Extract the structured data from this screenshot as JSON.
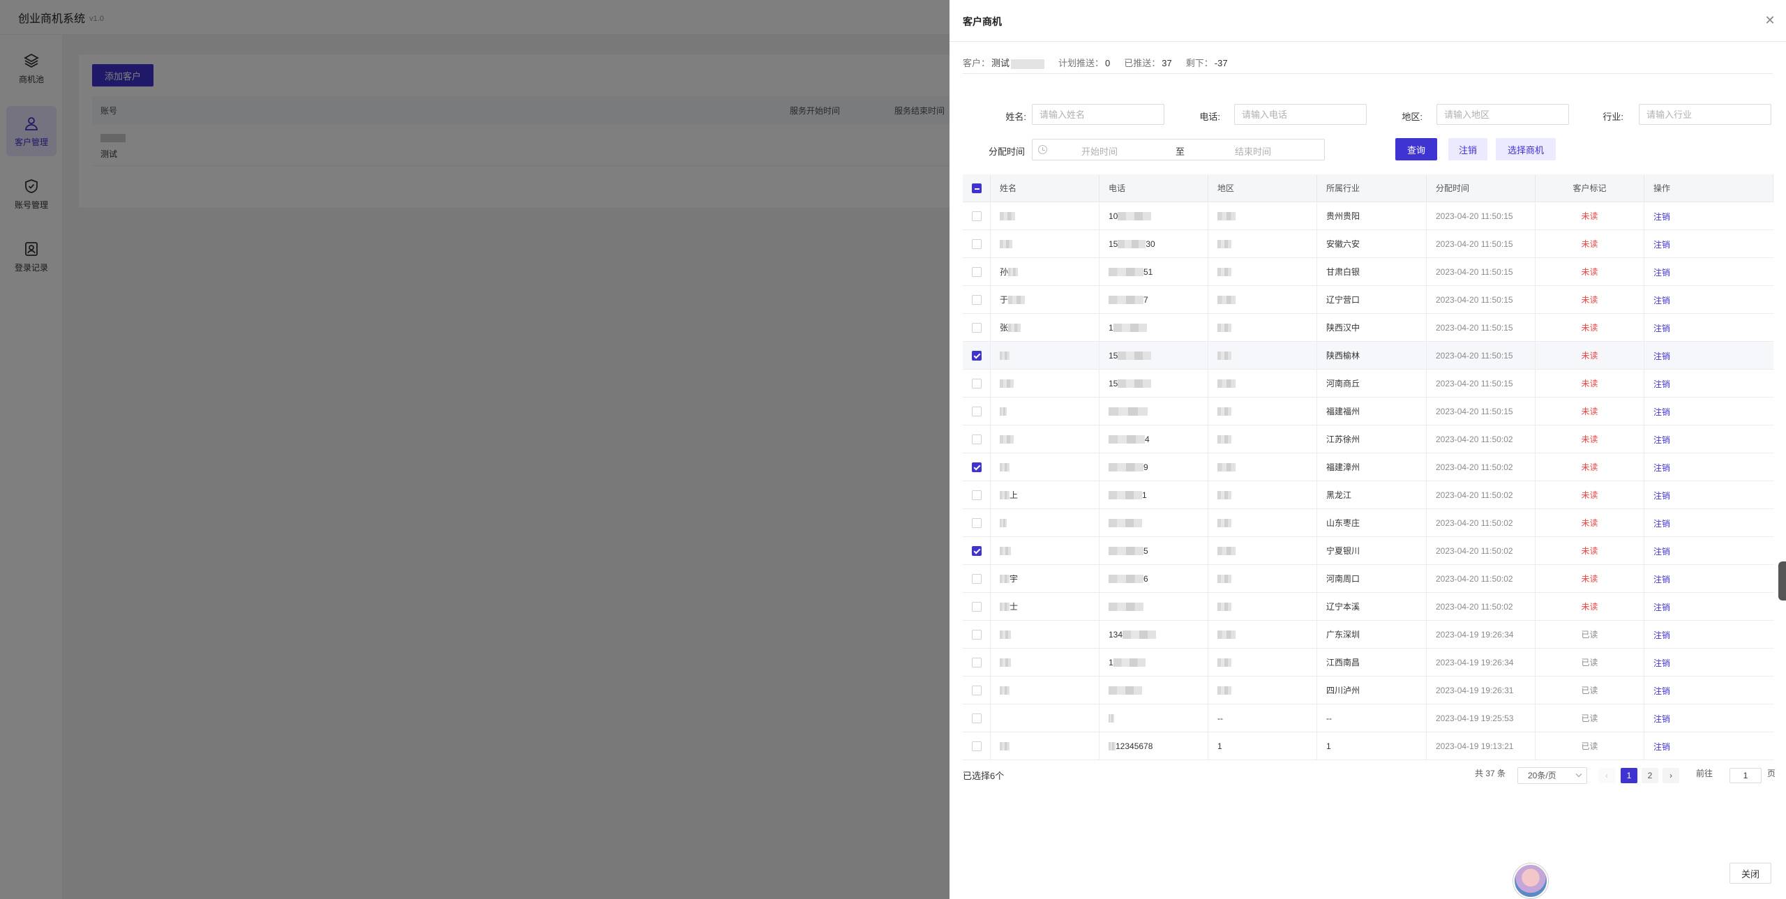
{
  "app": {
    "title": "创业商机系统",
    "version": "v1.0",
    "sidebar": [
      {
        "label": "商机池",
        "icon": "layers-icon",
        "active": false
      },
      {
        "label": "客户管理",
        "icon": "user-icon",
        "active": true
      },
      {
        "label": "账号管理",
        "icon": "shield-check-icon",
        "active": false
      },
      {
        "label": "登录记录",
        "icon": "portrait-icon",
        "active": false
      }
    ],
    "add_button": "添加客户",
    "table_headers": {
      "account": "账号",
      "service_start": "服务开始时间",
      "service_end": "服务结束时间"
    },
    "row": {
      "name": "测试"
    }
  },
  "drawer": {
    "title": "客户商机",
    "close_icon": "close-icon",
    "summary": {
      "customer_label": "客户：",
      "customer_value": "测试",
      "planned_label": "计划推送：",
      "planned_value": "0",
      "pushed_label": "已推送：",
      "pushed_value": "37",
      "remaining_label": "剩下：",
      "remaining_value": "-37"
    },
    "filters": {
      "name_label": "姓名:",
      "name_placeholder": "请输入姓名",
      "phone_label": "电话:",
      "phone_placeholder": "请输入电话",
      "region_label": "地区:",
      "region_placeholder": "请输入地区",
      "industry_label": "行业:",
      "industry_placeholder": "请输入行业",
      "time_label": "分配时间",
      "start_placeholder": "开始时间",
      "separator": "至",
      "end_placeholder": "结束时间",
      "query_button": "查询",
      "cancel_button": "注销",
      "select_button": "选择商机"
    },
    "table": {
      "headers": {
        "name": "姓名",
        "phone": "电话",
        "region": "地区",
        "industry": "所属行业",
        "time": "分配时间",
        "mark": "客户标记",
        "op": "操作"
      },
      "rows": [
        {
          "checked": false,
          "name": "",
          "name_suffix": "",
          "phone": "10",
          "phone_suffix": "",
          "industry": "贵州贵阳",
          "time": "2023-04-20 11:50:15",
          "mark": "未读",
          "op": "注销"
        },
        {
          "checked": false,
          "name": "",
          "name_suffix": "",
          "phone": "15",
          "phone_suffix": "30",
          "industry": "安徽六安",
          "time": "2023-04-20 11:50:15",
          "mark": "未读",
          "op": "注销"
        },
        {
          "checked": false,
          "name": "孙",
          "name_suffix": "",
          "phone": "",
          "phone_suffix": "51",
          "industry": "甘肃白银",
          "time": "2023-04-20 11:50:15",
          "mark": "未读",
          "op": "注销"
        },
        {
          "checked": false,
          "name": "于",
          "name_suffix": "",
          "phone": "",
          "phone_suffix": "7",
          "industry": "辽宁营口",
          "time": "2023-04-20 11:50:15",
          "mark": "未读",
          "op": "注销"
        },
        {
          "checked": false,
          "name": "张",
          "name_suffix": "",
          "phone": "1",
          "phone_suffix": "",
          "industry": "陕西汉中",
          "time": "2023-04-20 11:50:15",
          "mark": "未读",
          "op": "注销"
        },
        {
          "checked": true,
          "name": "",
          "name_suffix": "",
          "phone": "15",
          "phone_suffix": "",
          "industry": "陕西榆林",
          "time": "2023-04-20 11:50:15",
          "mark": "未读",
          "op": "注销"
        },
        {
          "checked": false,
          "name": "",
          "name_suffix": "",
          "phone": "15",
          "phone_suffix": "",
          "industry": "河南商丘",
          "time": "2023-04-20 11:50:15",
          "mark": "未读",
          "op": "注销"
        },
        {
          "checked": false,
          "name": "",
          "name_suffix": "",
          "phone": "",
          "phone_suffix": "",
          "industry": "福建福州",
          "time": "2023-04-20 11:50:15",
          "mark": "未读",
          "op": "注销"
        },
        {
          "checked": false,
          "name": "",
          "name_suffix": "",
          "phone": "",
          "phone_suffix": "4",
          "industry": "江苏徐州",
          "time": "2023-04-20 11:50:02",
          "mark": "未读",
          "op": "注销"
        },
        {
          "checked": true,
          "name": "",
          "name_suffix": "",
          "phone": "",
          "phone_suffix": "9",
          "industry": "福建漳州",
          "time": "2023-04-20 11:50:02",
          "mark": "未读",
          "op": "注销"
        },
        {
          "checked": false,
          "name": "",
          "name_suffix": "上",
          "phone": "",
          "phone_suffix": "1",
          "industry": "黑龙江",
          "time": "2023-04-20 11:50:02",
          "mark": "未读",
          "op": "注销"
        },
        {
          "checked": false,
          "name": "",
          "name_suffix": "",
          "phone": "",
          "phone_suffix": "",
          "industry": "山东枣庄",
          "time": "2023-04-20 11:50:02",
          "mark": "未读",
          "op": "注销"
        },
        {
          "checked": true,
          "name": "",
          "name_suffix": "",
          "phone": "",
          "phone_suffix": "5",
          "industry": "宁夏银川",
          "time": "2023-04-20 11:50:02",
          "mark": "未读",
          "op": "注销"
        },
        {
          "checked": false,
          "name": "",
          "name_suffix": "宇",
          "phone": "",
          "phone_suffix": "6",
          "industry": "河南周口",
          "time": "2023-04-20 11:50:02",
          "mark": "未读",
          "op": "注销"
        },
        {
          "checked": false,
          "name": "",
          "name_suffix": "士",
          "phone": "",
          "phone_suffix": "",
          "industry": "辽宁本溪",
          "time": "2023-04-20 11:50:02",
          "mark": "未读",
          "op": "注销"
        },
        {
          "checked": false,
          "name": "",
          "name_suffix": "",
          "phone": "134",
          "phone_suffix": "",
          "industry": "广东深圳",
          "time": "2023-04-19 19:26:34",
          "mark": "已读",
          "op": "注销"
        },
        {
          "checked": false,
          "name": "",
          "name_suffix": "",
          "phone": "1",
          "phone_suffix": "",
          "industry": "江西南昌",
          "time": "2023-04-19 19:26:34",
          "mark": "已读",
          "op": "注销"
        },
        {
          "checked": false,
          "name": "",
          "name_suffix": "",
          "phone": "",
          "phone_suffix": "",
          "industry": "四川泸州",
          "time": "2023-04-19 19:26:31",
          "mark": "已读",
          "op": "注销"
        },
        {
          "checked": false,
          "name": "",
          "name_suffix": "",
          "phone": "",
          "phone_suffix": "",
          "region_text": "--",
          "industry": "--",
          "time": "2023-04-19 19:25:53",
          "mark": "已读",
          "op": "注销"
        },
        {
          "checked": false,
          "name": "",
          "name_suffix": "",
          "phone": "",
          "phone_suffix": "12345678",
          "region_text": "1",
          "industry": "1",
          "time": "2023-04-19 19:13:21",
          "mark": "已读",
          "op": "注销"
        }
      ]
    },
    "selected_text": "已选择6个",
    "pagination": {
      "total": "共 37 条",
      "page_size": "20条/页",
      "prev": "‹",
      "pages": [
        "1",
        "2"
      ],
      "current": "1",
      "next": "›",
      "goto_label": "前往",
      "goto_value": "1",
      "goto_suffix": "页"
    },
    "close_button": "关闭"
  },
  "colors": {
    "primary": "#3f33d1",
    "unread": "#f04646",
    "read": "#8a8a8a"
  }
}
